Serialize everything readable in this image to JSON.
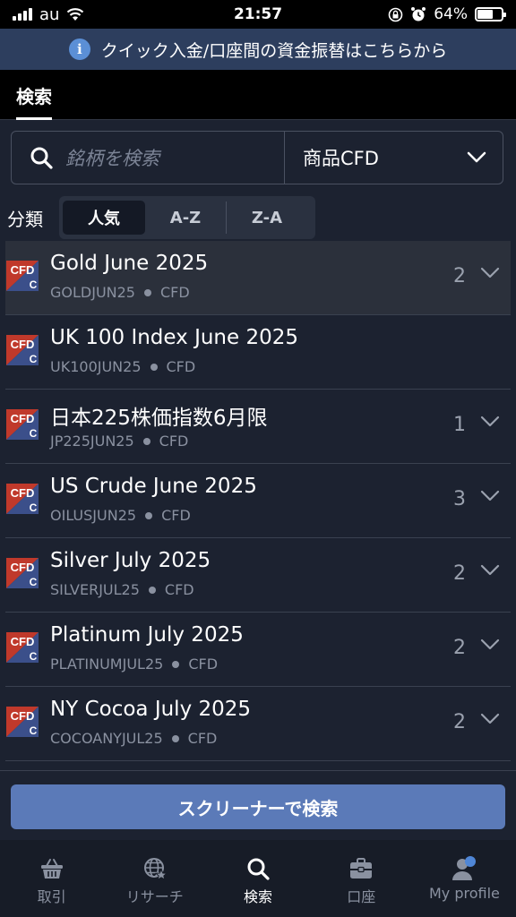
{
  "status_bar": {
    "carrier": "au",
    "time": "21:57",
    "battery": "64%",
    "battery_level": 0.64
  },
  "banner": {
    "text": "クイック入金/口座間の資金振替はこちらから"
  },
  "header": {
    "tab_label": "検索"
  },
  "search": {
    "placeholder": "銘柄を検索",
    "category": "商品CFD"
  },
  "sort": {
    "label": "分類",
    "options": [
      "人気",
      "A-Z",
      "Z-A"
    ],
    "selected": "人気"
  },
  "instruments": [
    {
      "name": "Gold June 2025",
      "code": "GOLDJUN25",
      "type": "CFD",
      "count": "2"
    },
    {
      "name": "UK 100 Index June 2025",
      "code": "UK100JUN25",
      "type": "CFD",
      "count": ""
    },
    {
      "name": "日本225株価指数6月限",
      "code": "JP225JUN25",
      "type": "CFD",
      "count": "1"
    },
    {
      "name": "US Crude June 2025",
      "code": "OILUSJUN25",
      "type": "CFD",
      "count": "3"
    },
    {
      "name": "Silver July 2025",
      "code": "SILVERJUL25",
      "type": "CFD",
      "count": "2"
    },
    {
      "name": "Platinum July 2025",
      "code": "PLATINUMJUL25",
      "type": "CFD",
      "count": "2"
    },
    {
      "name": "NY Cocoa July 2025",
      "code": "COCOANYJUL25",
      "type": "CFD",
      "count": "2"
    }
  ],
  "icon_text": {
    "top": "CFD",
    "bottom": "C"
  },
  "screener_button": "スクリーナーで検索",
  "bottom_nav": [
    {
      "label": "取引",
      "icon": "basket-icon"
    },
    {
      "label": "リサーチ",
      "icon": "globe-star-icon"
    },
    {
      "label": "検索",
      "icon": "search-icon"
    },
    {
      "label": "口座",
      "icon": "briefcase-icon"
    },
    {
      "label": "My profile",
      "icon": "profile-icon"
    }
  ],
  "colors": {
    "accent": "#5b7ab8",
    "banner": "#2d3e5e",
    "background": "#1c2230",
    "cfd_red": "#c0392b",
    "cfd_blue": "#3b4f8a"
  }
}
